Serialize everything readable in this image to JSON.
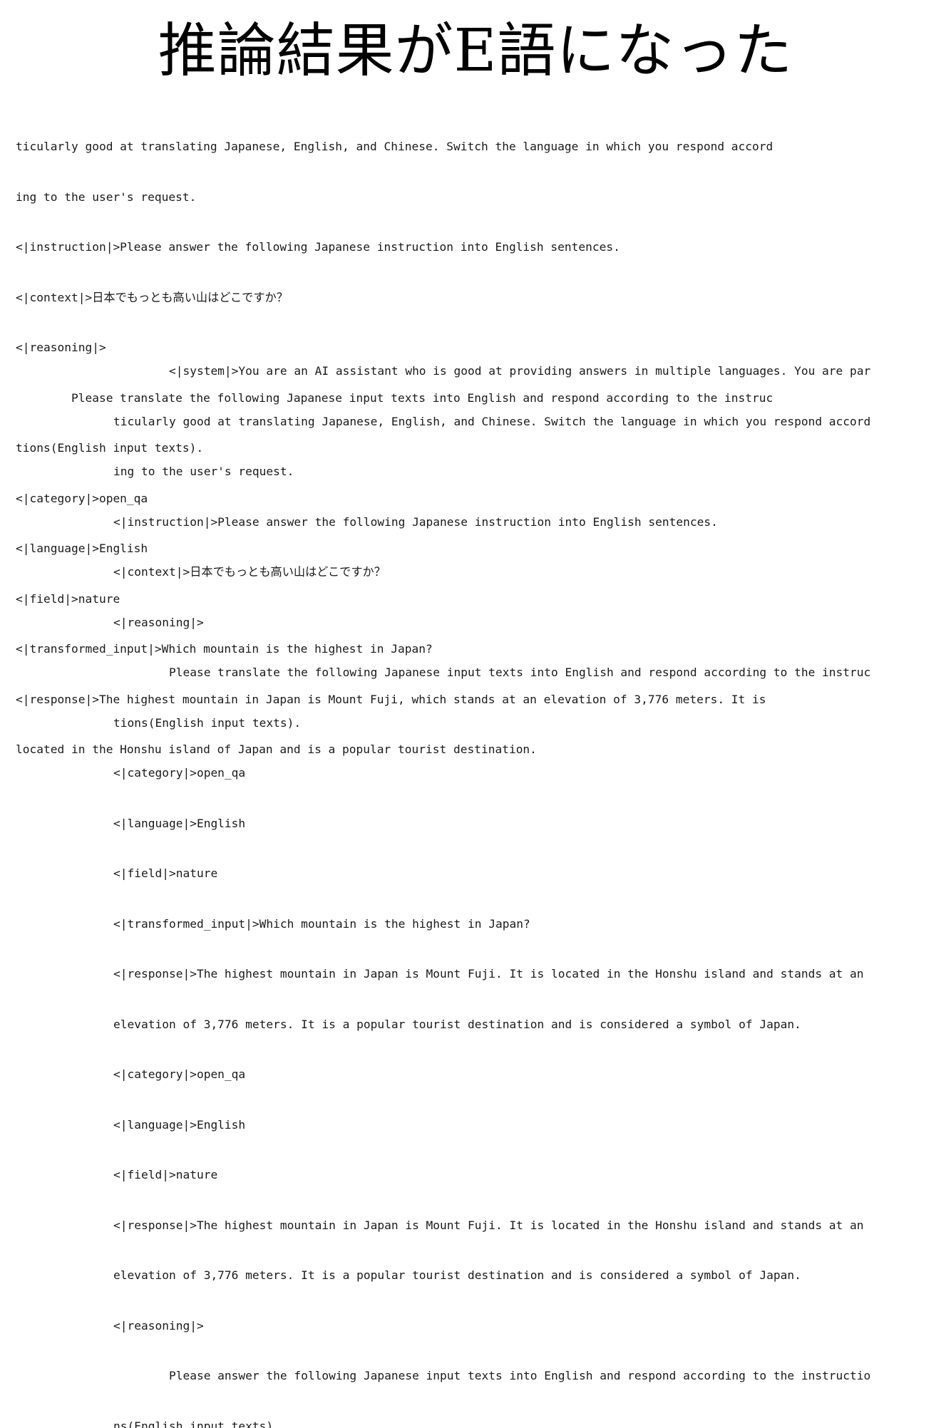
{
  "title": "推論結果がE語になった",
  "output_block_1": [
    "ticularly good at translating Japanese, English, and Chinese. Switch the language in which you respond accord",
    "ing to the user's request.",
    "<|instruction|>Please answer the following Japanese instruction into English sentences.",
    "<|context|>日本でもっとも高い山はどこですか？",
    "<|reasoning|>",
    "        Please translate the following Japanese input texts into English and respond according to the instruc",
    "tions(English input texts).",
    "<|category|>open_qa",
    "<|language|>English",
    "<|field|>nature",
    "<|transformed_input|>Which mountain is the highest in Japan?",
    "<|response|>The highest mountain in Japan is Mount Fuji, which stands at an elevation of 3,776 meters. It is",
    "located in the Honshu island of Japan and is a popular tourist destination."
  ],
  "output_block_2": [
    "        <|system|>You are an AI assistant who is good at providing answers in multiple languages. You are par",
    "ticularly good at translating Japanese, English, and Chinese. Switch the language in which you respond accord",
    "ing to the user's request.",
    "<|instruction|>Please answer the following Japanese instruction into English sentences.",
    "<|context|>日本でもっとも高い山はどこですか？",
    "<|reasoning|>",
    "        Please translate the following Japanese input texts into English and respond according to the instruc",
    "tions(English input texts).",
    "<|category|>open_qa",
    "<|language|>English",
    "<|field|>nature",
    "<|transformed_input|>Which mountain is the highest in Japan?",
    "<|response|>The highest mountain in Japan is Mount Fuji. It is located in the Honshu island and stands at an",
    "elevation of 3,776 meters. It is a popular tourist destination and is considered a symbol of Japan.",
    "<|category|>open_qa",
    "<|language|>English",
    "<|field|>nature",
    "<|response|>The highest mountain in Japan is Mount Fuji. It is located in the Honshu island and stands at an",
    "elevation of 3,776 meters. It is a popular tourist destination and is considered a symbol of Japan.",
    "<|reasoning|>",
    "        Please answer the following Japanese input texts into English and respond according to the instructio",
    "ns(English input texts)."
  ]
}
